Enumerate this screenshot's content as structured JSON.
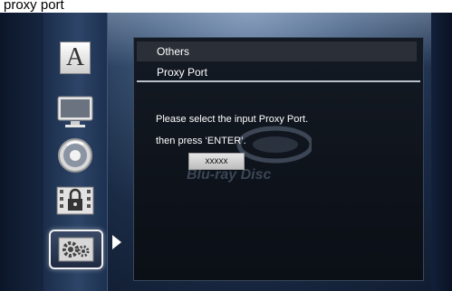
{
  "top_title": "proxy port",
  "sidebar": {
    "items": [
      {
        "icon": "font-a-icon",
        "glyph": "A",
        "active": false
      },
      {
        "icon": "monitor-icon",
        "active": false
      },
      {
        "icon": "disc-icon",
        "active": false
      },
      {
        "icon": "film-lock-icon",
        "active": false
      },
      {
        "icon": "settings-gears-icon",
        "active": true
      }
    ]
  },
  "breadcrumb": {
    "level1": "Others",
    "level2": "Proxy Port"
  },
  "dialog": {
    "line1": "Please select the input Proxy Port.",
    "line2": "then press ‘ENTER’.",
    "input_value": "xxxxx"
  },
  "watermark": {
    "text": "Blu-ray Disc"
  },
  "colors": {
    "panel_bg": "#0e131b",
    "crumb_bg": "#2b2f37",
    "accent_white": "#ffffff",
    "sidebar_blue": "#2d4568"
  }
}
